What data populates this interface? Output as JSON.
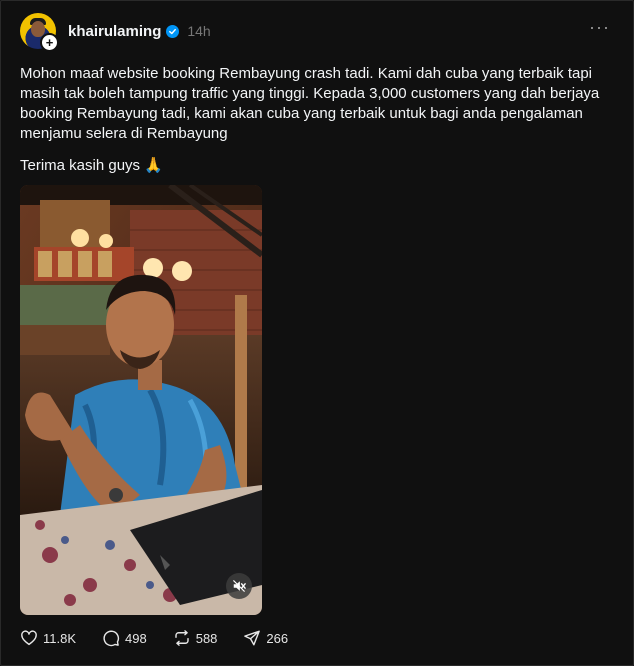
{
  "post": {
    "username": "khairulaming",
    "time": "14h",
    "more_label": "···",
    "paragraph1": "Mohon maaf website booking Rembayung crash tadi. Kami dah cuba yang terbaik tapi masih tak boleh tampung traffic yang tinggi. Kepada 3,000 customers yang dah berjaya booking Rembayung tadi, kami akan cuba yang terbaik untuk bagi anda pengalaman menjamu selera di Rembayung",
    "paragraph2": "Terima kasih guys 🙏"
  },
  "actions": {
    "likes": "11.8K",
    "replies": "498",
    "reposts": "588",
    "shares": "266"
  },
  "icons": {
    "verified": "verified-badge-icon",
    "more": "more-options-icon",
    "mute": "mute-icon",
    "like": "heart-icon",
    "reply": "comment-icon",
    "repost": "repost-icon",
    "share": "send-icon"
  },
  "colors": {
    "background": "#101010",
    "verified": "#0095f6",
    "muted_text": "#777777"
  }
}
